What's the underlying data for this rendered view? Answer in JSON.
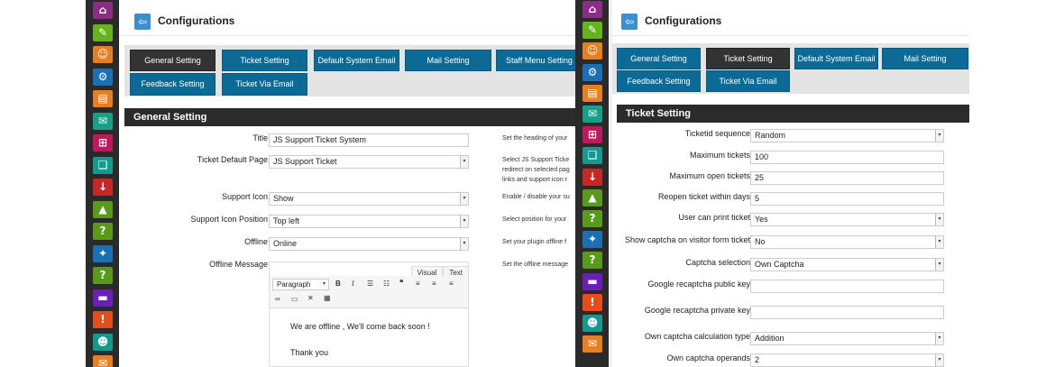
{
  "nav_icons": [
    {
      "name": "home-icon",
      "color": "#8b2c86",
      "glyph": "⌂"
    },
    {
      "name": "ticket-icon",
      "color": "#67b21f",
      "glyph": "✎"
    },
    {
      "name": "users-icon",
      "color": "#e67e22",
      "glyph": "☺"
    },
    {
      "name": "gears-icon",
      "color": "#1a6fb5",
      "glyph": "⚙"
    },
    {
      "name": "form-icon",
      "color": "#e67e22",
      "glyph": "▤"
    },
    {
      "name": "chat-icon",
      "color": "#16a085",
      "glyph": "✉"
    },
    {
      "name": "sitemap-icon",
      "color": "#c0185c",
      "glyph": "⊞"
    },
    {
      "name": "book-icon",
      "color": "#139a8f",
      "glyph": "❑"
    },
    {
      "name": "download-icon",
      "color": "#c62828",
      "glyph": "↓"
    },
    {
      "name": "megaphone-icon",
      "color": "#5a9a1a",
      "glyph": "▲"
    },
    {
      "name": "help-icon",
      "color": "#5a9a1a",
      "glyph": "?"
    },
    {
      "name": "network-icon",
      "color": "#1a6fb5",
      "glyph": "✦"
    },
    {
      "name": "faq-icon",
      "color": "#5a9a1a",
      "glyph": "?"
    },
    {
      "name": "messages-icon",
      "color": "#6a1fb5",
      "glyph": "▬"
    },
    {
      "name": "alert-icon",
      "color": "#e74c1c",
      "glyph": "!"
    },
    {
      "name": "user-settings-icon",
      "color": "#139a8f",
      "glyph": "☻"
    },
    {
      "name": "envelope-icon",
      "color": "#e67e22",
      "glyph": "✉"
    }
  ],
  "p1": {
    "title": "Configurations",
    "tabs": [
      "General Setting",
      "Ticket Setting",
      "Default System Email",
      "Mail Setting",
      "Staff Menu Setting",
      "Feedback Setting",
      "Ticket Via Email"
    ],
    "section_title": "General Setting",
    "rows": [
      {
        "label": "Title",
        "value": "JS Support Ticket System",
        "help": "Set the heading of your"
      },
      {
        "label": "Ticket Default Page",
        "value": "JS Support Ticket",
        "help1": "Select JS Support Ticke",
        "help2": "redirect on selected pag",
        "help3": "links and support icon r"
      },
      {
        "label": "Support Icon",
        "value": "Show",
        "help": "Enable / disable your su"
      },
      {
        "label": "Support Icon Position",
        "value": "Top left",
        "help": "Select position for your"
      },
      {
        "label": "Offline",
        "value": "Online",
        "help": "Set your plugin offline f"
      },
      {
        "label": "Offline Message",
        "help": "Set the offline message"
      }
    ],
    "editor": {
      "tab_visual": "Visual",
      "tab_text": "Text",
      "format": "Paragraph",
      "line1": "We are offline , We'll come back soon !",
      "line2": "Thank you"
    }
  },
  "p2": {
    "title": "Configurations",
    "tabs": [
      "General Setting",
      "Ticket Setting",
      "Default System Email",
      "Mail Setting",
      "Feedback Setting",
      "Ticket Via Email"
    ],
    "section_title": "Ticket Setting",
    "rows": [
      {
        "label": "Ticketid sequence",
        "value": "Random"
      },
      {
        "label": "Maximum tickets",
        "value": "100"
      },
      {
        "label": "Maximum open tickets",
        "value": "25"
      },
      {
        "label": "Reopen ticket within days",
        "value": "5"
      },
      {
        "label": "User can print ticket",
        "value": "Yes"
      },
      {
        "label": "Show captcha on visitor form ticket",
        "value": "No"
      },
      {
        "label": "Captcha selection",
        "value": "Own Captcha"
      },
      {
        "label": "Google recaptcha public key",
        "value": ""
      },
      {
        "label": "Google recaptcha private key",
        "value": ""
      },
      {
        "label": "Own captcha calculation type",
        "value": "Addition"
      },
      {
        "label": "Own captcha operands",
        "value": "2"
      }
    ]
  }
}
